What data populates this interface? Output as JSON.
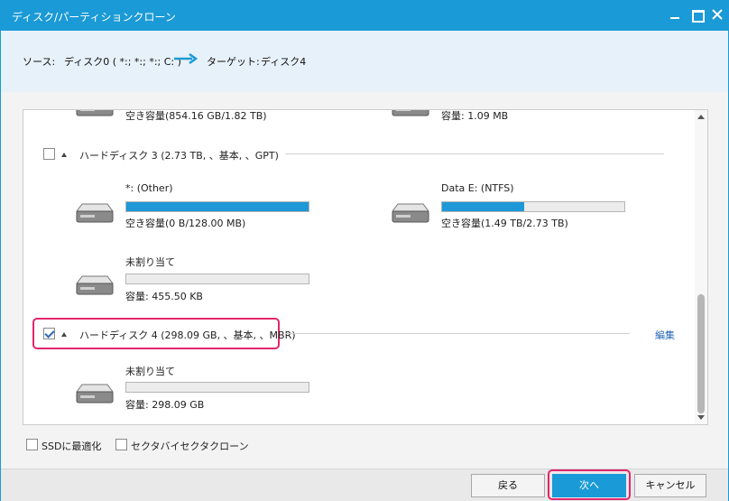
{
  "window": {
    "title": "ディスク/パーティションクローン"
  },
  "route": {
    "source_label": "ソース:",
    "source_value": "ディスク0 ( *:; *:; *:; C: )",
    "target_label": "ターゲット:",
    "target_value": "ディスク4"
  },
  "top_partial": {
    "left_free": "空き容量(854.16 GB/1.82 TB)",
    "right_free": "容量: 1.09 MB"
  },
  "disk3": {
    "header": "ハードディスク 3 (2.73 TB, 、基本, 、GPT)",
    "checked": false,
    "partitions": [
      {
        "name": "*: (Other)",
        "free": "空き容量(0 B/128.00 MB)",
        "fill_fraction": 1.0
      },
      {
        "name": "Data E: (NTFS)",
        "free": "空き容量(1.49 TB/2.73 TB)",
        "fill_fraction": 0.45
      },
      {
        "name": "未割り当て",
        "free": "容量: 455.50 KB",
        "fill_fraction": 0.0
      }
    ]
  },
  "disk4": {
    "header": "ハードディスク 4 (298.09 GB, 、基本, 、MBR)",
    "checked": true,
    "edit_label": "編集",
    "partitions": [
      {
        "name": "未割り当て",
        "free": "容量: 298.09 GB",
        "fill_fraction": 0.0
      }
    ]
  },
  "options": {
    "ssd_label": "SSDに最適化",
    "sector_label": "セクタバイセクタクローン"
  },
  "buttons": {
    "back": "戻る",
    "next": "次へ",
    "cancel": "キャンセル"
  },
  "colors": {
    "accent": "#1a9ad6",
    "highlight": "#e2276c",
    "link": "#2568b8"
  }
}
